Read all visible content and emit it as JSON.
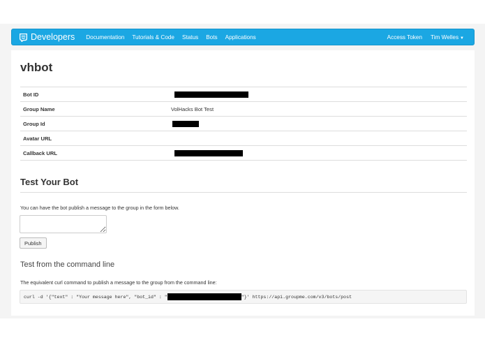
{
  "navbar": {
    "brand": "Developers",
    "brand_icon": "groupme-logo-icon",
    "links": [
      "Documentation",
      "Tutorials & Code",
      "Status",
      "Bots",
      "Applications"
    ],
    "right": {
      "access_token": "Access Token",
      "user": "Tim Welles"
    },
    "color": "#1ba7e3"
  },
  "bot": {
    "name": "vhbot",
    "fields": [
      {
        "label": "Bot ID",
        "value": "",
        "redacted": true
      },
      {
        "label": "Group Name",
        "value": "VolHacks Bot Test",
        "redacted": false
      },
      {
        "label": "Group Id",
        "value": "",
        "redacted": true
      },
      {
        "label": "Avatar URL",
        "value": "",
        "redacted": false
      },
      {
        "label": "Callback URL",
        "value": "",
        "redacted": true
      }
    ]
  },
  "test": {
    "title": "Test Your Bot",
    "help": "You can have the bot publish a message to the group in the form below.",
    "message_value": "",
    "publish_label": "Publish"
  },
  "cli": {
    "title": "Test from the command line",
    "help": "The equivalent curl command to publish a message to the group from the command line:",
    "command_prefix": "curl -d '{\"text\" : \"Your message here\", \"bot_id\" : \"",
    "command_suffix": "\"}' https://api.groupme.com/v3/bots/post"
  }
}
